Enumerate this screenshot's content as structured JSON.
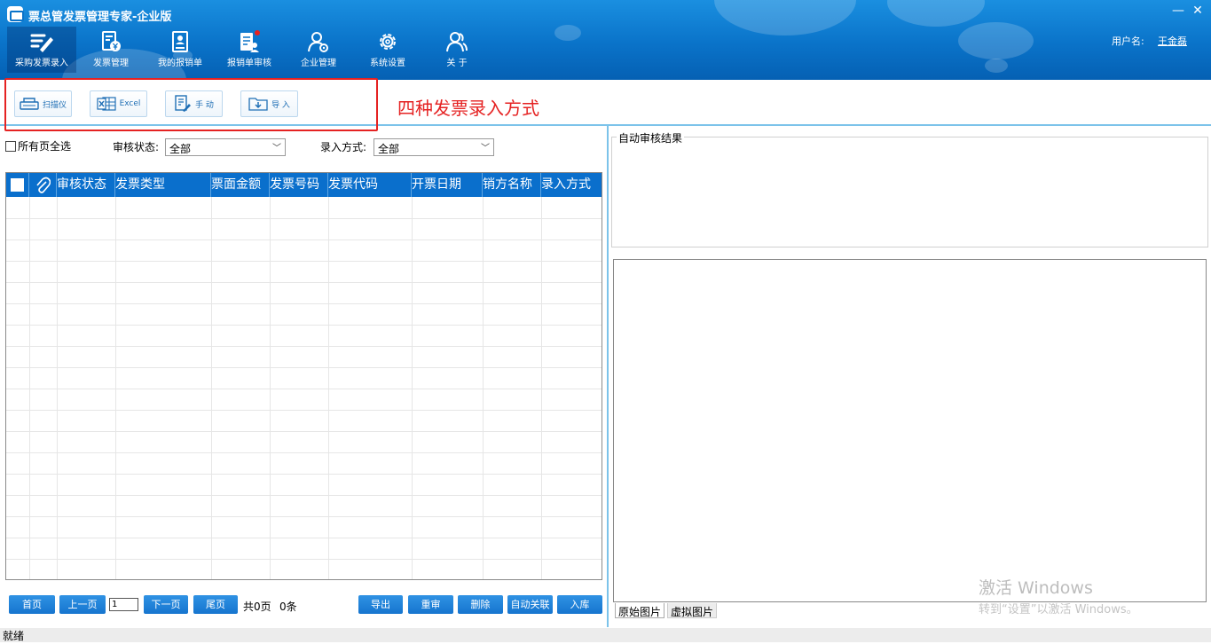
{
  "window": {
    "title": "票总管发票管理专家-企业版",
    "min": "—",
    "close": "✕"
  },
  "nav": [
    {
      "label": "采购发票录入",
      "icon": "pen-edit-icon"
    },
    {
      "label": "发票管理",
      "icon": "invoice-yen-icon"
    },
    {
      "label": "我的报销单",
      "icon": "report-person-icon"
    },
    {
      "label": "报销单审核",
      "icon": "audit-doc-icon"
    },
    {
      "label": "企业管理",
      "icon": "user-gear-icon"
    },
    {
      "label": "系统设置",
      "icon": "gear-icon"
    },
    {
      "label": "关  于",
      "icon": "users-icon"
    }
  ],
  "user": {
    "label": "用户名:",
    "name": "王金磊"
  },
  "toolbar": {
    "scanner": "扫描仪",
    "excel": "Excel",
    "manual": "手  动",
    "import": "导  入",
    "annotation": "四种发票录入方式"
  },
  "filters": {
    "select_all": "所有页全选",
    "status_label": "审核状态:",
    "status_value": "全部",
    "entry_label": "录入方式:",
    "entry_value": "全部"
  },
  "table": {
    "columns": [
      "审核状态",
      "发票类型",
      "票面金额",
      "发票号码",
      "发票代码",
      "开票日期",
      "销方名称",
      "录入方式"
    ]
  },
  "pager": {
    "first": "首页",
    "prev": "上一页",
    "page": "1",
    "next": "下一页",
    "last": "尾页",
    "total_pages": "共0页",
    "total_items": "0条",
    "export": "导出",
    "recheck": "重审",
    "delete": "删除",
    "auto_link": "自动关联",
    "store": "入库"
  },
  "right": {
    "result_title": "自动审核结果",
    "tab_original": "原始图片",
    "tab_virtual": "虚拟图片",
    "watermark1": "激活 Windows",
    "watermark2": "转到“设置”以激活 Windows。"
  },
  "status": "就绪",
  "colors": {
    "header": "#0a73c9",
    "accent": "#e52222",
    "table_header": "#0a6fcc"
  }
}
